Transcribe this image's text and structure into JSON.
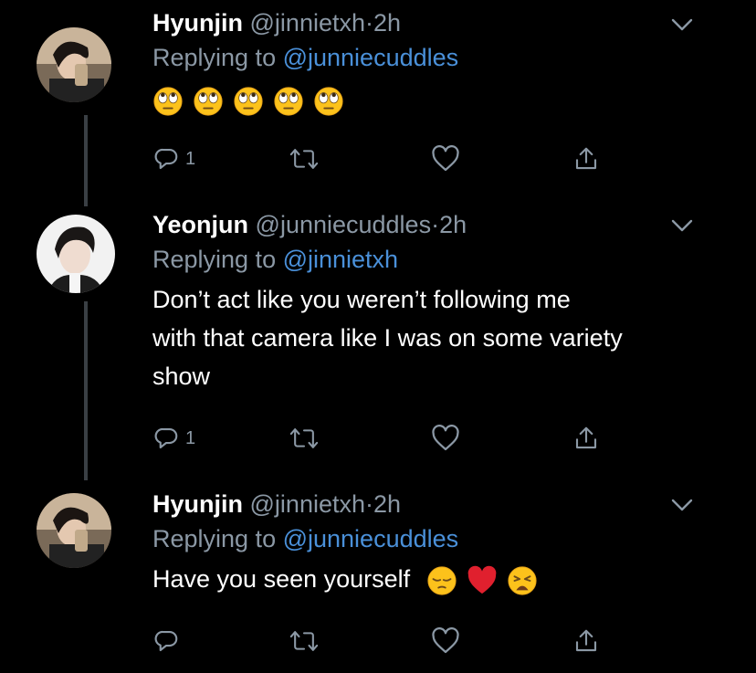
{
  "tweets": [
    {
      "name": "Hyunjin",
      "handle": "@jinnietxh",
      "dot": "·",
      "time": "2h",
      "replying_prefix": "Replying to ",
      "replying_to": "@junniecuddles",
      "text": "",
      "emojis": [
        "face-with-rolling-eyes",
        "face-with-rolling-eyes",
        "face-with-rolling-eyes",
        "face-with-rolling-eyes",
        "face-with-rolling-eyes"
      ],
      "reply_count": "1"
    },
    {
      "name": "Yeonjun",
      "handle": "@junniecuddles",
      "dot": "·",
      "time": "2h",
      "replying_prefix": "Replying to ",
      "replying_to": "@jinnietxh",
      "text_lines": [
        "Don’t act like you weren’t following me",
        "with that camera like I was on some variety",
        "show"
      ],
      "reply_count": "1"
    },
    {
      "name": "Hyunjin",
      "handle": "@jinnietxh",
      "dot": "·",
      "time": "2h",
      "replying_prefix": "Replying to ",
      "replying_to": "@junniecuddles",
      "text": "Have you seen yourself",
      "emojis": [
        "pensive-face",
        "red-heart",
        "weary-face"
      ],
      "reply_count": ""
    }
  ],
  "colors": {
    "background": "#000000",
    "secondary": "#8b98a5",
    "mention": "#4a90d9",
    "thread_line": "#3a3f44"
  }
}
